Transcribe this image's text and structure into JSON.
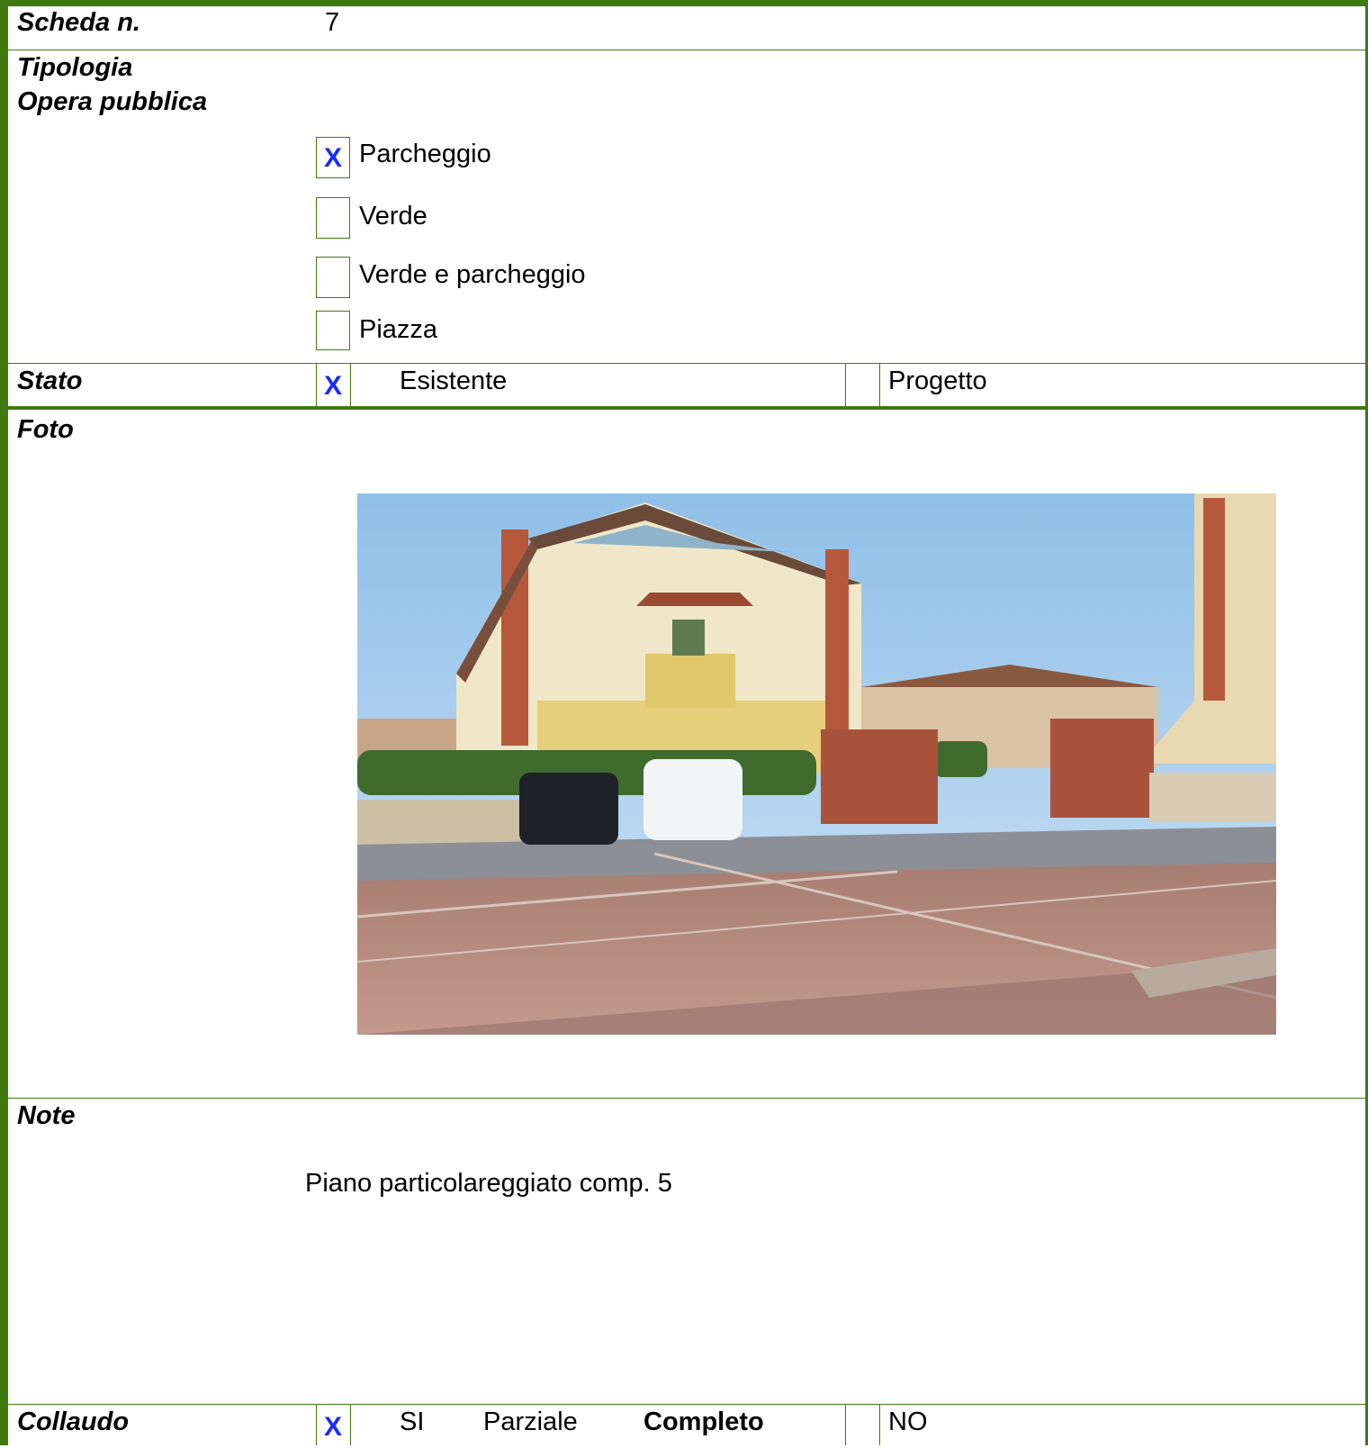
{
  "header": {
    "scheda_label": "Scheda n.",
    "scheda_value": "7"
  },
  "tipologia": {
    "label_line1": "Tipologia",
    "label_line2": "Opera pubblica",
    "options": [
      {
        "label": "Parcheggio",
        "mark": "X"
      },
      {
        "label": "Verde",
        "mark": ""
      },
      {
        "label": "Verde e parcheggio",
        "mark": ""
      },
      {
        "label": "Piazza",
        "mark": ""
      }
    ]
  },
  "stato": {
    "label": "Stato",
    "mark_esistente": "X",
    "esistente": "Esistente",
    "progetto": "Progetto"
  },
  "foto": {
    "label": "Foto"
  },
  "note": {
    "label": "Note",
    "text": "Piano particolareggiato comp. 5"
  },
  "collaudo": {
    "label": "Collaudo",
    "mark": "X",
    "si": "SI",
    "parziale": "Parziale",
    "completo": "Completo",
    "no": "NO"
  },
  "colors": {
    "border": "#3f7a10",
    "mark": "#1a2bff"
  }
}
